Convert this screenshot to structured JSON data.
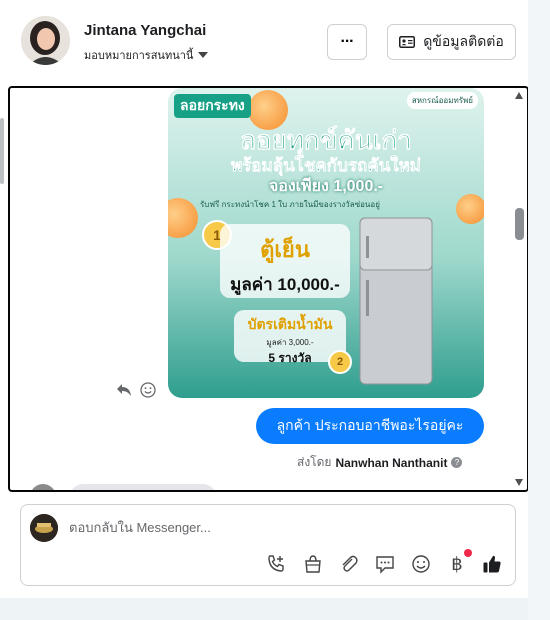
{
  "header": {
    "user_name": "Jintana Yangchai",
    "assign_label": "มอบหมายการสนทนานี้",
    "more_label": "···",
    "contact_label": "ดูข้อมูลติดต่อ"
  },
  "promo": {
    "brand": "ลอยกระทง",
    "logo": "สหกรณ์ออมทรัพย์",
    "line1": "ลอยทุกข์คันเก่า",
    "line2": "พร้อมลุ้นโชคกับรถคันใหม่",
    "line3": "จองเพียง 1,000.-",
    "sub": "รับฟรี กระทงนำโชค 1 ใบ ภายในมีของรางวัลซ่อนอยู่",
    "prize_rank_1": "1",
    "prize_name": "ตู้เย็น",
    "prize_value": "มูลค่า 10,000.-",
    "voucher_name": "บัตรเติมน้ำมัน",
    "voucher_value": "มูลค่า 3,000.-",
    "voucher_count": "5 รางวัล",
    "prize_rank_2": "2"
  },
  "messages": {
    "outgoing_text": "ลูกค้า  ประกอบอาชีพอะไรอยู่คะ",
    "sent_by_prefix": "ส่งโดย",
    "sent_by_name": "Nanwhan Nanthanit"
  },
  "composer": {
    "placeholder": "ตอบกลับใน Messenger...",
    "currency_symbol": "฿"
  },
  "colors": {
    "accent": "#0a7cff",
    "promo_green": "#16a085",
    "notification": "#f02849"
  },
  "icons": [
    "chevron-down-icon",
    "more-icon",
    "contact-card-icon",
    "reply-icon",
    "emoji-icon",
    "info-icon",
    "call-add-icon",
    "shopping-bag-icon",
    "paperclip-icon",
    "chat-bubble-icon",
    "baht-icon",
    "thumbs-up-icon"
  ]
}
